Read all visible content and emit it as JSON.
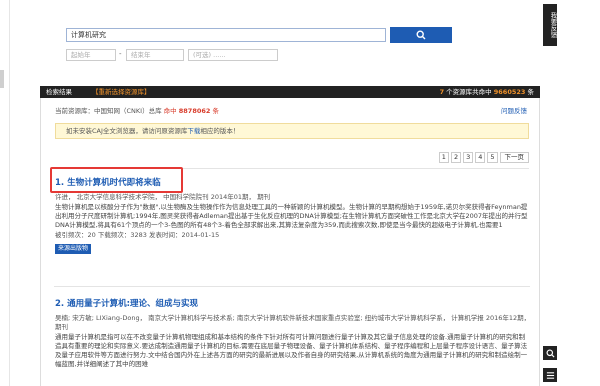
{
  "search": {
    "query": "计算机研究",
    "date_from_placeholder": "起始年",
    "date_to_placeholder": "结束年",
    "dash": "-",
    "keyword_placeholder": "(可选) ......"
  },
  "feedback": {
    "label": "我要反馈"
  },
  "results_bar": {
    "title": "检索结果",
    "reselect": "【重新选择资源库】",
    "count_prefix": "个资源库共命中",
    "count_suffix": "条",
    "db_count": "7",
    "total_hits": "9660523"
  },
  "current_db": {
    "label": "当前资源库：",
    "name": "中国知网（CNKI）总库",
    "hit_prefix": "命中",
    "hit_count": "8878062",
    "hit_suffix": "条",
    "issue_link": "问题反馈"
  },
  "install_notice": {
    "text": "如未安装CAJ全文浏览器，请访问原资源库",
    "link": "下载",
    "suffix": "相应的版本！"
  },
  "pager": {
    "pages": [
      "1",
      "2",
      "3",
      "4",
      "5"
    ],
    "next": "下一页"
  },
  "results": [
    {
      "num": "1.",
      "title": "生物计算机时代即将来临",
      "meta": "许进，  北京大学信息科学技术学院，  中国科学院院刊 2014年01期，  期刊",
      "abstract": "生物计算机是以核酸分子作为\"数据\",以生物酶及生物操作作为信息处理工具的一种新颖的计算机模型。生物计算的早期构想始于1959年,诺贝尔奖获得者Feynman提出利用分子尺度研制计算机;1994年,图灵奖获得者Adleman提出基于生化反应机理的DNA计算模型;在生物计算机方面突破性工作是北京大学在2007年提出的并行型DNA计算模型,将具有61个顶点的一个3-色图的所有48个3-着色全部求解出来,其算法复杂度为359,而此搜索次数,即使是当今最快的超级电子计算机,也需要1",
      "stats": "被引频次：20  下载频次：3283  发表时间：2014-01-15",
      "source_btn": "来源出版物"
    },
    {
      "num": "2.",
      "title": "通用量子计算机:理论、组成与实现",
      "meta": "吴楠; 宋方敏; LIXiang-Dong，  南京大学计算机科学与技术系; 南京大学计算机软件新技术国家重点实验室; 纽约城市大学计算机科学系，  计算机学报 2016年12期，  期刊",
      "abstract": "通用量子计算机是指可以在不改变量子计算机物理组成和基本结构的条件下针对所有可计算问题进行量子计算及其它量子信息处理的设备.通用量子计算机的研究和制造具有重要的理论和实际意义.要达成制造通用量子计算机的目标,需要在底层量子物理设备、量子计算机体系结构、量子程序编程和上层量子程序设计语言、量子算法及量子应用软件等方面进行努力.文中结合国内外在上述各方面的研究的最新进展以及作者自身的研究结果,从计算机系统的角度为通用量子计算机的研究和制造绘制一幅蓝图,并详细阐述了其中的困难"
    }
  ]
}
